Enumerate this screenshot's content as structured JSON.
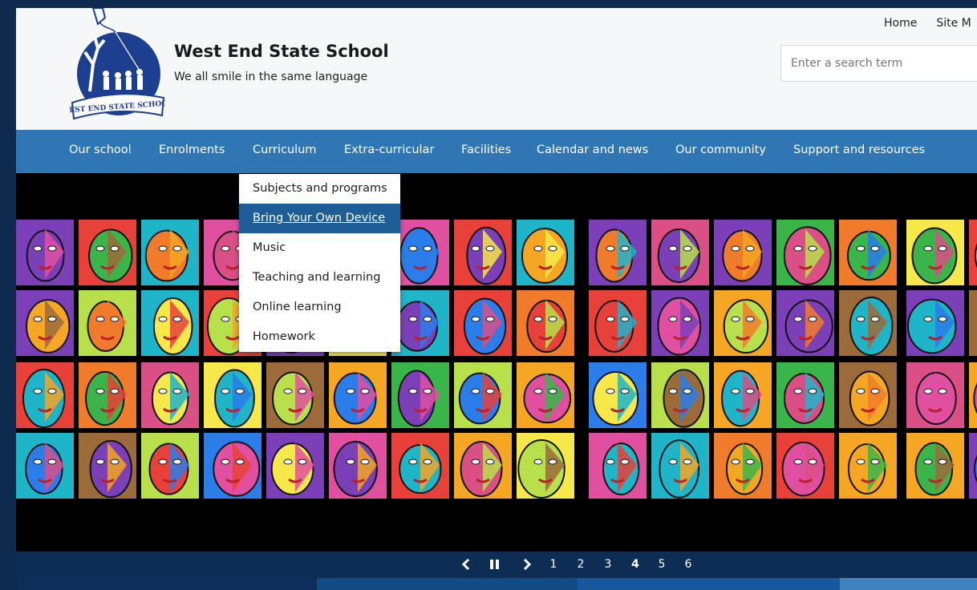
{
  "header": {
    "site_title": "West End State School",
    "tagline": "We all smile in the same language",
    "logo_text": "WEST END STATE SCHOOL",
    "top_links": [
      "Home",
      "Site M"
    ],
    "search_placeholder": "Enter a search term"
  },
  "nav": {
    "items": [
      "Our school",
      "Enrolments",
      "Curriculum",
      "Extra-curricular",
      "Facilities",
      "Calendar and news",
      "Our community",
      "Support and resources"
    ]
  },
  "dropdown": {
    "items": [
      "Subjects and programs",
      "Bring Your Own Device",
      "Music",
      "Teaching and learning",
      "Online learning",
      "Homework"
    ],
    "active_index": 1
  },
  "carousel": {
    "prev_icon": "chevron-left-icon",
    "pause_icon": "pause-icon",
    "next_icon": "chevron-right-icon",
    "slides": [
      "1",
      "2",
      "3",
      "4",
      "5",
      "6"
    ],
    "active_slide": "4"
  },
  "colors": {
    "nav": "#2f77b4",
    "dropdown_active": "#1f5d96",
    "controls": "#0e2d55"
  }
}
